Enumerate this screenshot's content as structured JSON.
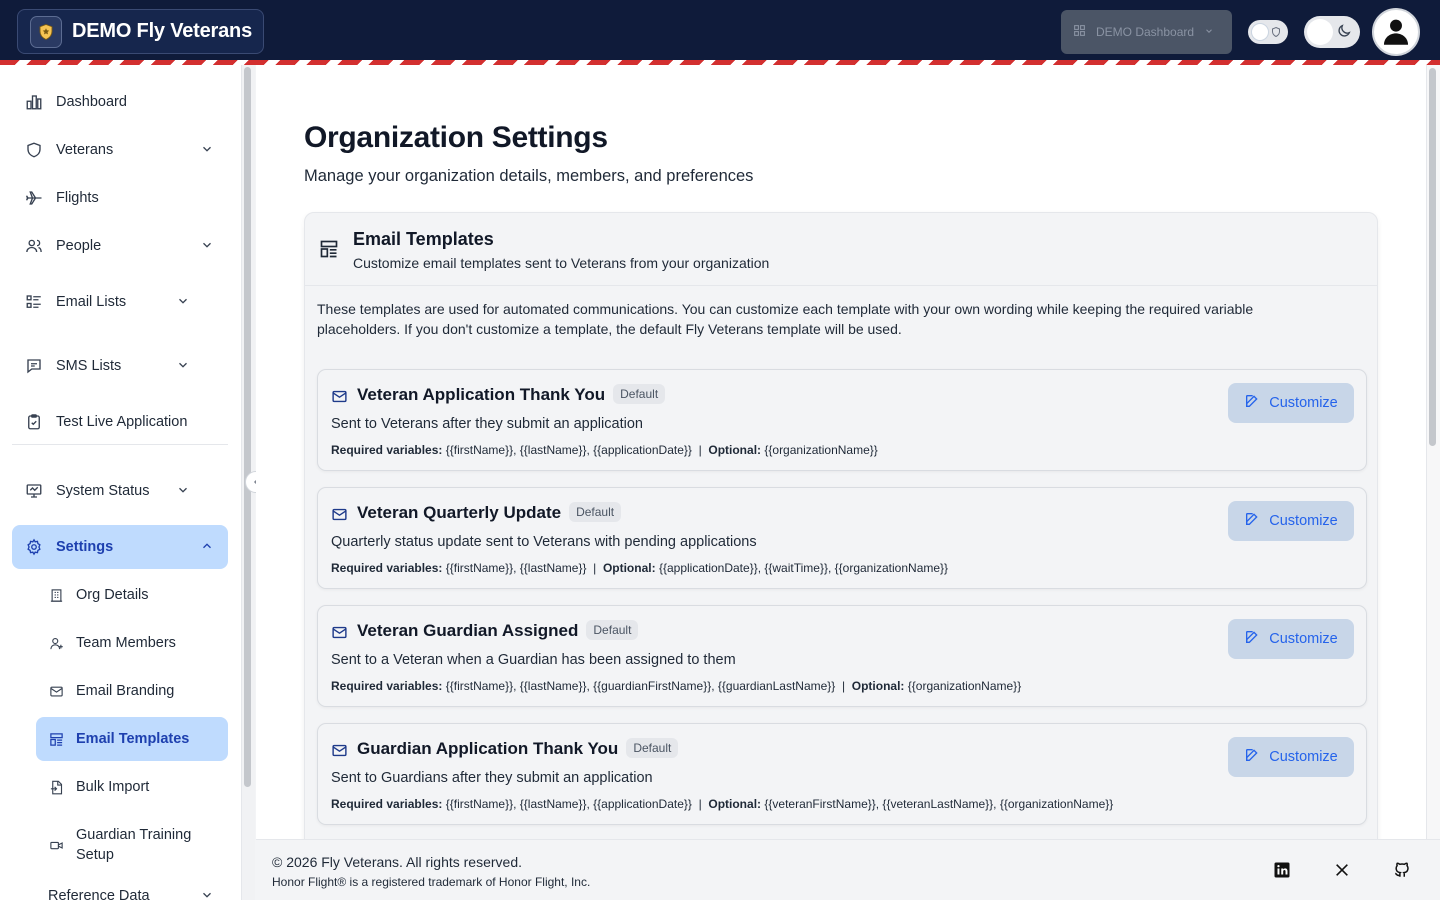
{
  "header": {
    "brand_title": "DEMO Fly Veterans",
    "org_selector_label": "DEMO Dashboard"
  },
  "sidebar": {
    "items": {
      "dashboard": "Dashboard",
      "veterans": "Veterans",
      "flights": "Flights",
      "people": "People",
      "email_lists": "Email Lists",
      "sms_lists": "SMS Lists",
      "test_live_application": "Test Live Application",
      "system_status": "System Status",
      "settings": "Settings",
      "reference_data": "Reference Data"
    },
    "settings_children": {
      "org_details": "Org Details",
      "team_members": "Team Members",
      "email_branding": "Email Branding",
      "email_templates": "Email Templates",
      "bulk_import": "Bulk Import",
      "guardian_training_setup_line1": "Guardian Training",
      "guardian_training_setup_line2": "Setup"
    }
  },
  "page": {
    "title": "Organization Settings",
    "subtitle": "Manage your organization details, members, and preferences"
  },
  "card": {
    "title": "Email Templates",
    "description": "Customize email templates sent to Veterans from your organization",
    "intro": "These templates are used for automated communications. You can customize each template with your own wording while keeping the required variable placeholders. If you don't customize a template, the default Fly Veterans template will be used."
  },
  "labels": {
    "required": "Required variables:",
    "optional": "Optional:",
    "customize": "Customize",
    "default_badge": "Default"
  },
  "templates": [
    {
      "name": "Veteran Application Thank You",
      "description": "Sent to Veterans after they submit an application",
      "required": "{{firstName}}, {{lastName}}, {{applicationDate}}",
      "optional": "{{organizationName}}"
    },
    {
      "name": "Veteran Quarterly Update",
      "description": "Quarterly status update sent to Veterans with pending applications",
      "required": "{{firstName}}, {{lastName}}",
      "optional": "{{applicationDate}}, {{waitTime}}, {{organizationName}}"
    },
    {
      "name": "Veteran Guardian Assigned",
      "description": "Sent to a Veteran when a Guardian has been assigned to them",
      "required": "{{firstName}}, {{lastName}}, {{guardianFirstName}}, {{guardianLastName}}",
      "optional": "{{organizationName}}"
    },
    {
      "name": "Guardian Application Thank You",
      "description": "Sent to Guardians after they submit an application",
      "required": "{{firstName}}, {{lastName}}, {{applicationDate}}",
      "optional": "{{veteranFirstName}}, {{veteranLastName}}, {{organizationName}}"
    }
  ],
  "footer": {
    "copyright": "© 2026 Fly Veterans. All rights reserved.",
    "trademark": "Honor Flight® is a registered trademark of Honor Flight, Inc."
  },
  "colors": {
    "header_bg": "#0f1b3a",
    "accent_blue": "#2563eb",
    "active_bg": "#bfdbfe",
    "stripe_red": "#d32f2f"
  }
}
